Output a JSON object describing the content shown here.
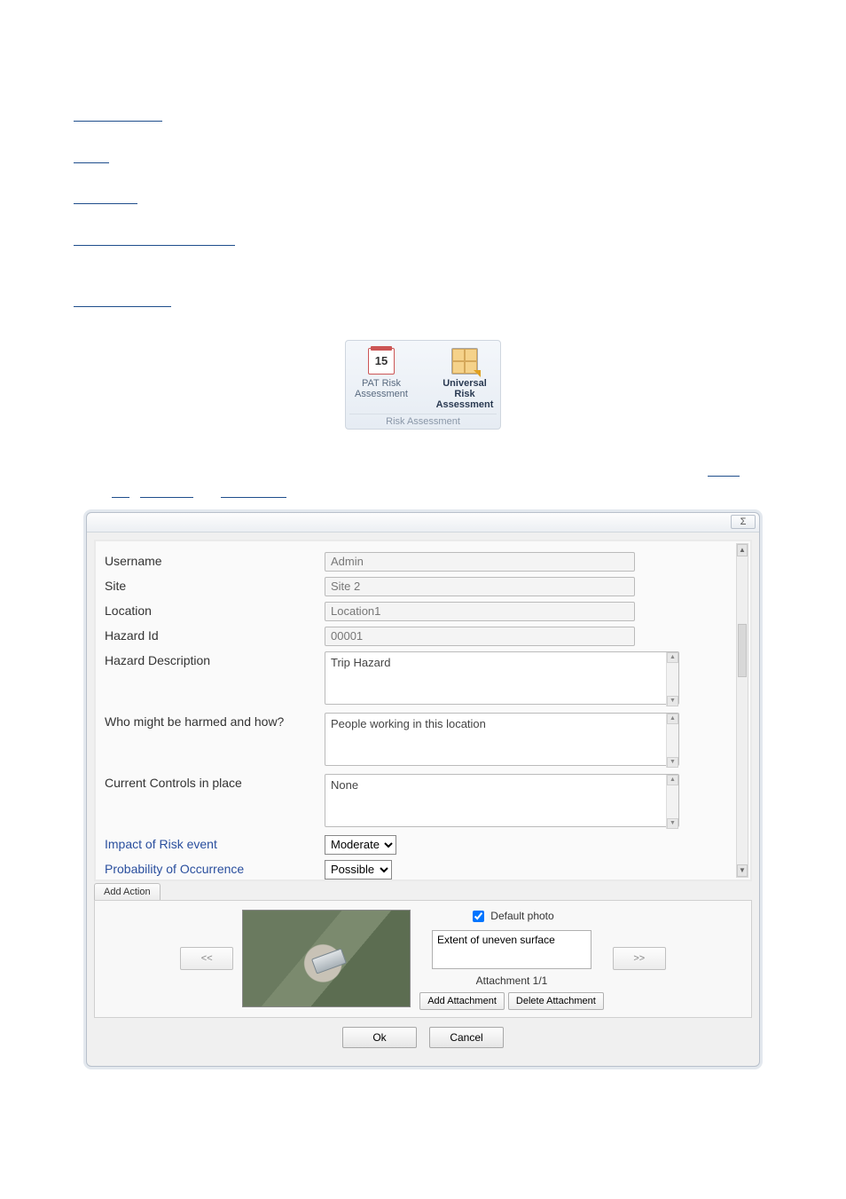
{
  "ribbon": {
    "item1_line1": "PAT Risk",
    "item1_line2": "Assessment",
    "item2_line1": "Universal Risk",
    "item2_line2": "Assessment",
    "caption": "Risk Assessment",
    "cal_num": "15"
  },
  "dialog": {
    "close_glyph": "Σ",
    "labels": {
      "username": "Username",
      "site": "Site",
      "location": "Location",
      "hazard_id": "Hazard Id",
      "hazard_desc": "Hazard Description",
      "who_harmed": "Who might be harmed and how?",
      "controls": "Current Controls in place",
      "impact": "Impact of Risk event",
      "probability": "Probability of Occurrence"
    },
    "values": {
      "username": "Admin",
      "site": "Site 2",
      "location": "Location1",
      "hazard_id": "00001",
      "hazard_desc": "Trip Hazard",
      "who_harmed": "People working in this location",
      "controls": "None",
      "impact": "Moderate",
      "probability": "Possible"
    },
    "add_action": "Add Action",
    "attach": {
      "prev": "<<",
      "next": ">>",
      "default_photo": "Default photo",
      "caption": "Extent of uneven surface",
      "count": "Attachment 1/1",
      "add": "Add Attachment",
      "del": "Delete Attachment"
    },
    "footer": {
      "ok": "Ok",
      "cancel": "Cancel"
    }
  }
}
